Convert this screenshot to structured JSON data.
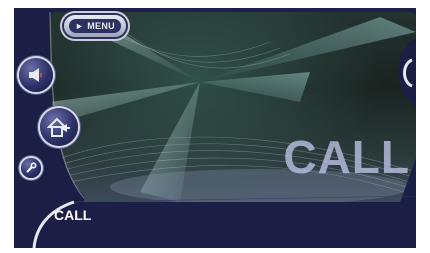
{
  "menu": {
    "label": "MENU",
    "arrow": "►"
  },
  "buttons": {
    "audio_icon": "speaker-icon",
    "home_icon": "home-back-icon",
    "settings_icon": "wrench-icon"
  },
  "screen": {
    "background_title": "CALL",
    "bottom_label": "CALL"
  },
  "colors": {
    "frame": "#1b1f45",
    "accent": "#c9cedb",
    "title_overlay": "#bec3e6"
  }
}
